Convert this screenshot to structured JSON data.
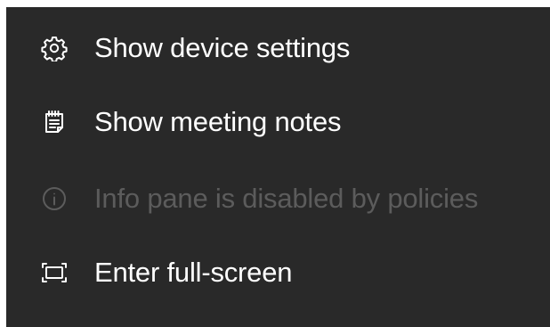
{
  "menu": {
    "items": [
      {
        "label": "Show device settings",
        "icon": "gear-icon",
        "enabled": true
      },
      {
        "label": "Show meeting notes",
        "icon": "notes-icon",
        "enabled": true
      },
      {
        "label": "Info pane is disabled by policies",
        "icon": "info-icon",
        "enabled": false
      },
      {
        "label": "Enter full-screen",
        "icon": "fullscreen-icon",
        "enabled": true
      }
    ]
  },
  "colors": {
    "background": "#292929",
    "text": "#ffffff",
    "disabled_text": "#5c5c5c"
  }
}
